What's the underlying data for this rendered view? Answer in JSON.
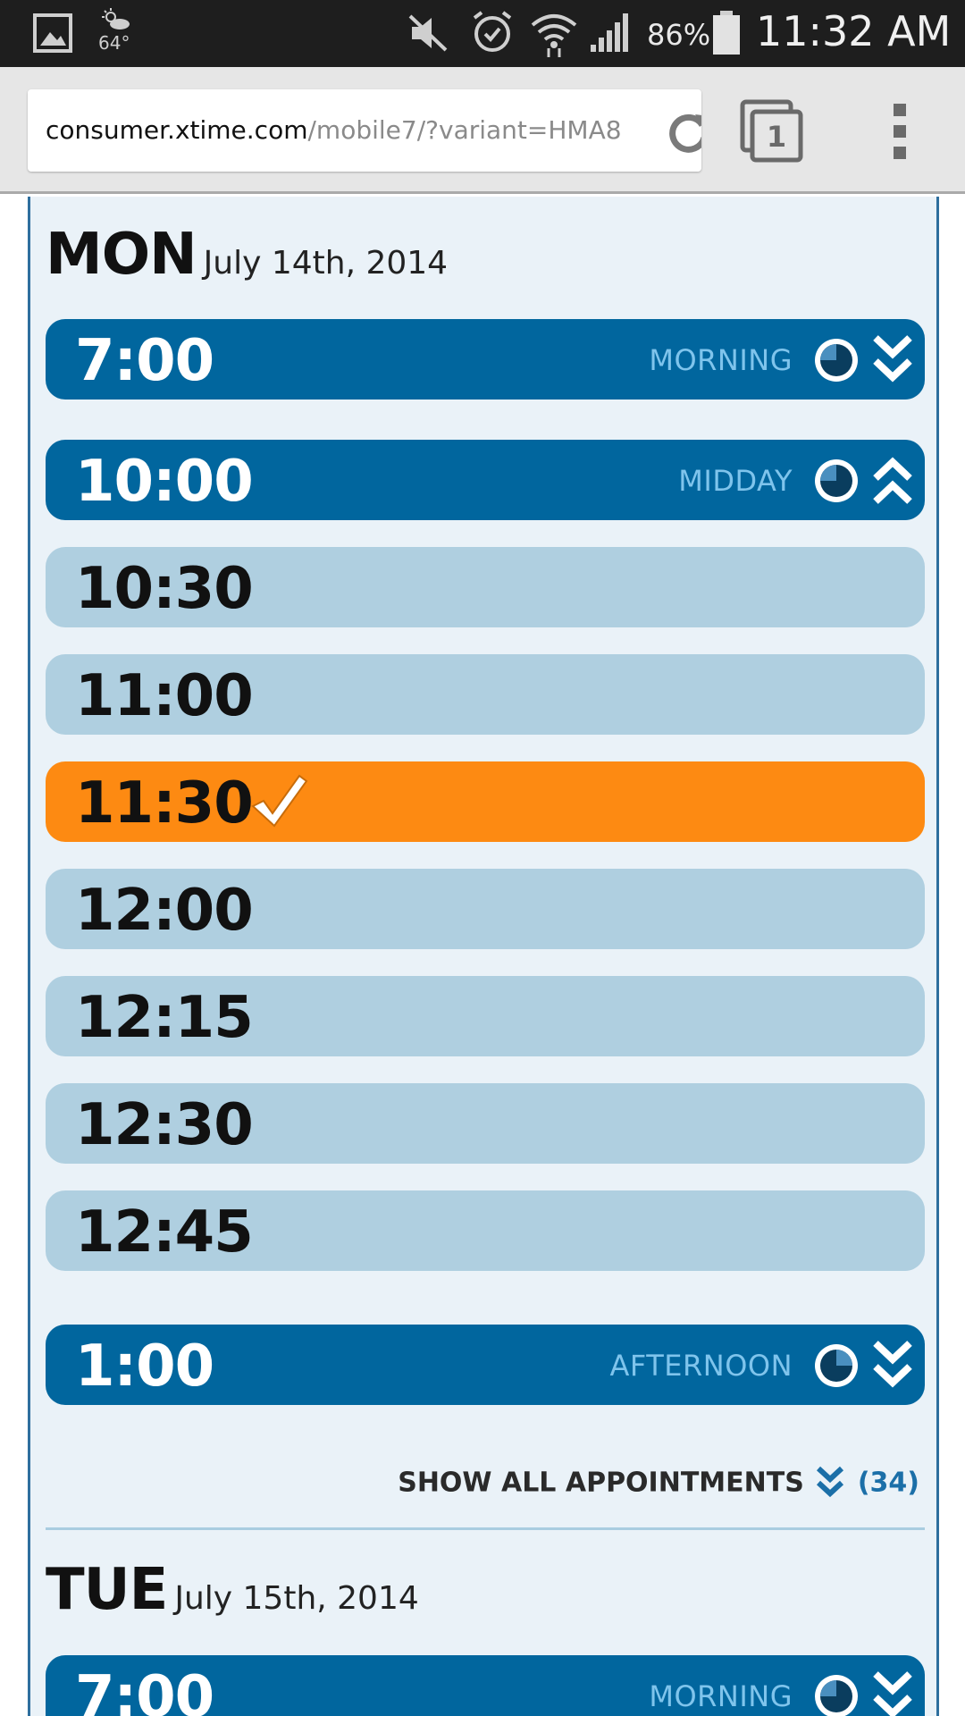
{
  "status_bar": {
    "weather_temp": "64°",
    "battery_percent": "86%",
    "time": "11:32 AM",
    "icons": [
      "gallery-icon",
      "weather-icon",
      "mute-icon",
      "alarm-icon",
      "wifi-icon",
      "signal-icon",
      "battery-icon"
    ]
  },
  "browser": {
    "url_domain": "consumer.xtime.com",
    "url_path": "/mobile7/?variant=HMA8",
    "tab_count": "1",
    "icons": [
      "reload-icon",
      "tabs-icon",
      "overflow-menu-icon"
    ]
  },
  "days": [
    {
      "name": "MON",
      "date": "July 14th, 2014",
      "slots": [
        {
          "time": "7:00",
          "kind": "header",
          "period": "MORNING",
          "expanded": false
        },
        {
          "time": "10:00",
          "kind": "header",
          "period": "MIDDAY",
          "expanded": true
        },
        {
          "time": "10:30",
          "kind": "available"
        },
        {
          "time": "11:00",
          "kind": "available"
        },
        {
          "time": "11:30",
          "kind": "selected"
        },
        {
          "time": "12:00",
          "kind": "available"
        },
        {
          "time": "12:15",
          "kind": "available"
        },
        {
          "time": "12:30",
          "kind": "available"
        },
        {
          "time": "12:45",
          "kind": "available"
        },
        {
          "time": "1:00",
          "kind": "header",
          "period": "AFTERNOON",
          "expanded": false
        }
      ],
      "show_all": {
        "label": "SHOW ALL APPOINTMENTS",
        "count": "(34)"
      }
    },
    {
      "name": "TUE",
      "date": "July 15th, 2014",
      "slots": [
        {
          "time": "7:00",
          "kind": "header",
          "period": "MORNING",
          "expanded": false
        }
      ]
    }
  ],
  "colors": {
    "header_slot": "#01669e",
    "available_slot": "#afcfe0",
    "selected_slot": "#fd8a12",
    "period_text": "#7fc4ec",
    "panel_bg": "#eaf2f8"
  }
}
